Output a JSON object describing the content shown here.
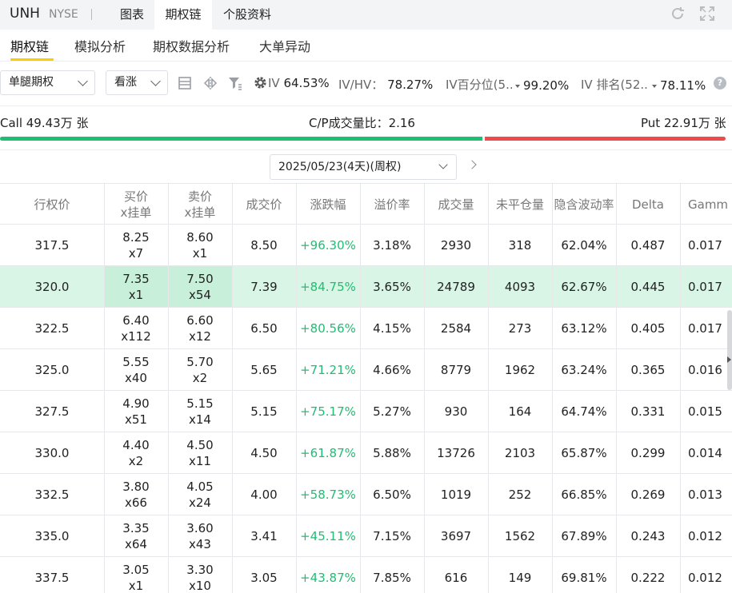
{
  "header": {
    "ticker": "UNH",
    "exchange": "NYSE",
    "tabs": [
      {
        "label": "图表",
        "active": false
      },
      {
        "label": "期权链",
        "active": true
      },
      {
        "label": "个股资料",
        "active": false
      }
    ]
  },
  "subtabs": [
    {
      "label": "期权链",
      "active": true
    },
    {
      "label": "模拟分析",
      "active": false
    },
    {
      "label": "期权数据分析",
      "active": false
    },
    {
      "label": "大单异动",
      "active": false
    }
  ],
  "filters": {
    "strategy": "单腿期权",
    "direction": "看涨",
    "iv_label": "IV",
    "iv_value": "64.53%",
    "ivhv_label": "IV/HV：",
    "ivhv_value": "78.27%",
    "ivpct_label": "IV百分位(5...",
    "ivpct_value": "99.20%",
    "ivrank_label": "IV 排名(52...",
    "ivrank_value": "78.11%"
  },
  "volume": {
    "call_text": "Call 49.43万 张",
    "ratio_text": "C/P成交量比：2.16",
    "put_text": "Put 22.91万 张",
    "call_share": 0.683
  },
  "expiry": {
    "label": "2025/05/23(4天)(周权)"
  },
  "table": {
    "headers": {
      "strike": "行权价",
      "bid_1": "买价",
      "bid_2": "x挂单",
      "ask_1": "卖价",
      "ask_2": "x挂单",
      "last": "成交价",
      "chg": "涨跌幅",
      "premium": "溢价率",
      "volume": "成交量",
      "oi": "未平仓量",
      "iv": "隐含波动率",
      "delta": "Delta",
      "gamma": "Gamm"
    },
    "rows": [
      {
        "strike": "317.5",
        "bid": "8.25",
        "bid_size": "x7",
        "ask": "8.60",
        "ask_size": "x1",
        "last": "8.50",
        "chg": "+96.30%",
        "premium": "3.18%",
        "volume": "2930",
        "oi": "318",
        "iv": "62.04%",
        "delta": "0.487",
        "gamma": "0.017",
        "highlight": false
      },
      {
        "strike": "320.0",
        "bid": "7.35",
        "bid_size": "x1",
        "ask": "7.50",
        "ask_size": "x54",
        "last": "7.39",
        "chg": "+84.75%",
        "premium": "3.65%",
        "volume": "24789",
        "oi": "4093",
        "iv": "62.67%",
        "delta": "0.445",
        "gamma": "0.017",
        "highlight": true
      },
      {
        "strike": "322.5",
        "bid": "6.40",
        "bid_size": "x112",
        "ask": "6.60",
        "ask_size": "x12",
        "last": "6.50",
        "chg": "+80.56%",
        "premium": "4.15%",
        "volume": "2584",
        "oi": "273",
        "iv": "63.12%",
        "delta": "0.405",
        "gamma": "0.017",
        "highlight": false
      },
      {
        "strike": "325.0",
        "bid": "5.55",
        "bid_size": "x40",
        "ask": "5.70",
        "ask_size": "x2",
        "last": "5.65",
        "chg": "+71.21%",
        "premium": "4.66%",
        "volume": "8779",
        "oi": "1962",
        "iv": "63.24%",
        "delta": "0.365",
        "gamma": "0.016",
        "highlight": false
      },
      {
        "strike": "327.5",
        "bid": "4.90",
        "bid_size": "x51",
        "ask": "5.15",
        "ask_size": "x14",
        "last": "5.15",
        "chg": "+75.17%",
        "premium": "5.27%",
        "volume": "930",
        "oi": "164",
        "iv": "64.74%",
        "delta": "0.331",
        "gamma": "0.015",
        "highlight": false
      },
      {
        "strike": "330.0",
        "bid": "4.40",
        "bid_size": "x2",
        "ask": "4.50",
        "ask_size": "x11",
        "last": "4.50",
        "chg": "+61.87%",
        "premium": "5.88%",
        "volume": "13726",
        "oi": "2103",
        "iv": "65.87%",
        "delta": "0.299",
        "gamma": "0.014",
        "highlight": false
      },
      {
        "strike": "332.5",
        "bid": "3.80",
        "bid_size": "x66",
        "ask": "4.05",
        "ask_size": "x24",
        "last": "4.00",
        "chg": "+58.73%",
        "premium": "6.50%",
        "volume": "1019",
        "oi": "252",
        "iv": "66.85%",
        "delta": "0.269",
        "gamma": "0.013",
        "highlight": false
      },
      {
        "strike": "335.0",
        "bid": "3.35",
        "bid_size": "x64",
        "ask": "3.60",
        "ask_size": "x43",
        "last": "3.41",
        "chg": "+45.11%",
        "premium": "7.15%",
        "volume": "3697",
        "oi": "1562",
        "iv": "67.89%",
        "delta": "0.243",
        "gamma": "0.012",
        "highlight": false
      },
      {
        "strike": "337.5",
        "bid": "3.05",
        "bid_size": "x1",
        "ask": "3.30",
        "ask_size": "x10",
        "last": "3.05",
        "chg": "+43.87%",
        "premium": "7.85%",
        "volume": "616",
        "oi": "149",
        "iv": "69.81%",
        "delta": "0.222",
        "gamma": "0.012",
        "highlight": false
      }
    ]
  },
  "colors": {
    "up_green": "#1dbf73",
    "down_red": "#ee4c4c",
    "accent_yellow": "#ffcc00",
    "highlight_row": "#d8f5e6"
  },
  "icons": [
    "refresh-icon",
    "fullscreen-icon",
    "table-layout-icon",
    "compare-icon",
    "filter-icon",
    "gear-icon",
    "help-icon",
    "chevron-right-icon"
  ]
}
